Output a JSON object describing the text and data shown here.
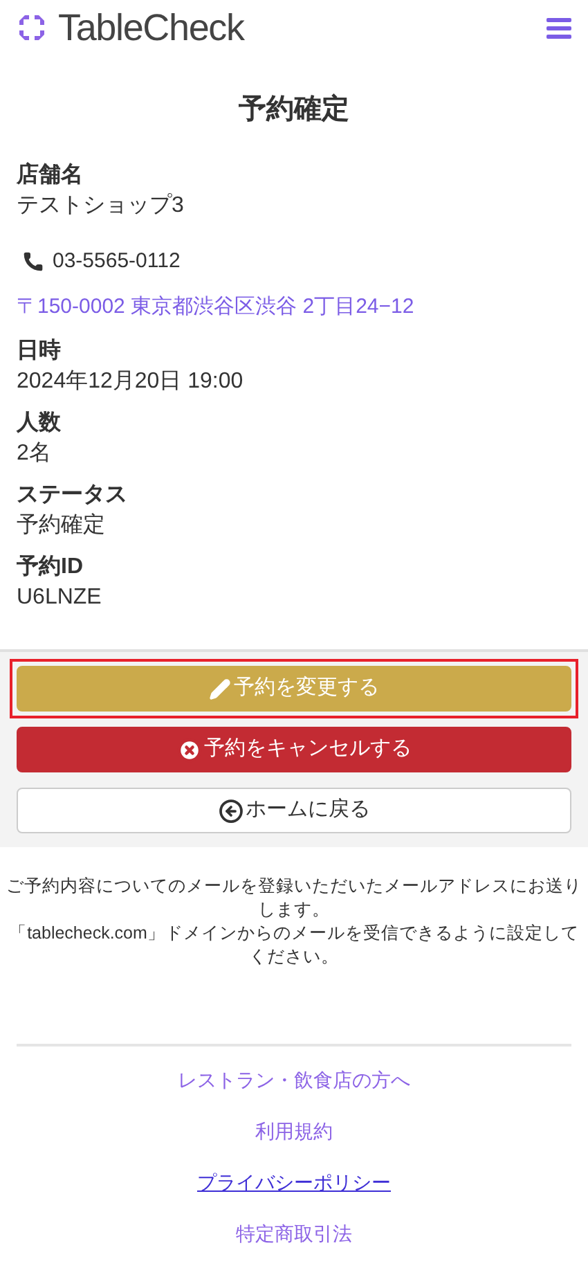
{
  "header": {
    "logo": "TableCheck"
  },
  "title": "予約確定",
  "details": [
    {
      "kind": "field",
      "label": "店舗名",
      "value": "テストショップ3"
    },
    {
      "kind": "phone",
      "value": "03-5565-0112"
    },
    {
      "kind": "address",
      "value": "〒150-0002 東京都渋谷区渋谷 2丁目24−12"
    },
    {
      "kind": "field",
      "label": "日時",
      "value": "2024年12月20日 19:00"
    },
    {
      "kind": "field",
      "label": "人数",
      "value": "2名"
    },
    {
      "kind": "field",
      "label": "ステータス",
      "value": "予約確定"
    },
    {
      "kind": "field",
      "label": "予約ID",
      "value": "U6LNZE"
    }
  ],
  "buttons": [
    {
      "kind": "change",
      "label": "予約を変更する",
      "highlighted": true
    },
    {
      "kind": "cancel",
      "label": "予約をキャンセルする",
      "highlighted": false
    },
    {
      "kind": "home",
      "label": "ホームに戻る",
      "highlighted": false
    }
  ],
  "notice": [
    "ご予約内容についてのメールを登録いただいたメールアドレスにお送りします。",
    "「tablecheck.com」ドメインからのメールを受信できるように設定してください。"
  ],
  "footer_links": [
    {
      "label": "レストラン・飲食店の方へ",
      "visited": false
    },
    {
      "label": "利用規約",
      "visited": false
    },
    {
      "label": "プライバシーポリシー",
      "visited": true
    },
    {
      "label": "特定商取引法",
      "visited": false
    }
  ]
}
